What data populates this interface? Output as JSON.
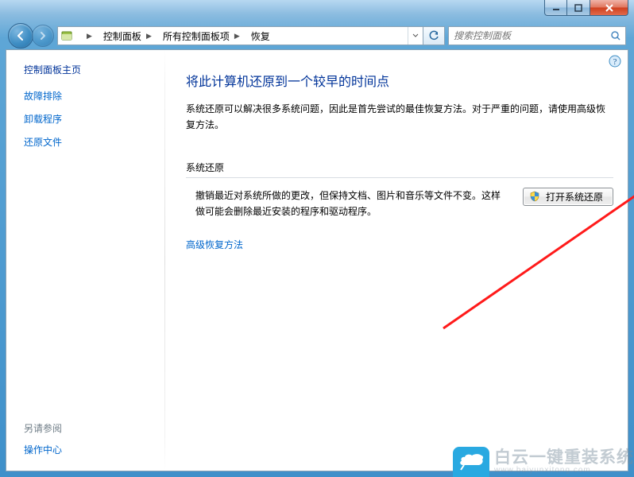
{
  "titlebar": {
    "min_name": "minimize-icon",
    "max_name": "maximize-icon",
    "close_name": "close-icon"
  },
  "breadcrumb": {
    "items": [
      "控制面板",
      "所有控制面板项",
      "恢复"
    ]
  },
  "search": {
    "placeholder": "搜索控制面板"
  },
  "sidebar": {
    "home": "控制面板主页",
    "links": [
      "故障排除",
      "卸载程序",
      "还原文件"
    ],
    "see_also_header": "另请参阅",
    "see_also_links": [
      "操作中心"
    ]
  },
  "main": {
    "title": "将此计算机还原到一个较早的时间点",
    "intro": "系统还原可以解决很多系统问题，因此是首先尝试的最佳恢复方法。对于严重的问题，请使用高级恢复方法。",
    "section_header": "系统还原",
    "section_desc": "撤销最近对系统所做的更改，但保持文档、图片和音乐等文件不变。这样做可能会删除最近安装的程序和驱动程序。",
    "button_label": "打开系统还原",
    "advanced_link": "高级恢复方法"
  },
  "watermark": {
    "line1": "白云一键重装系统",
    "line2": "www.baiyunxitong.com"
  }
}
